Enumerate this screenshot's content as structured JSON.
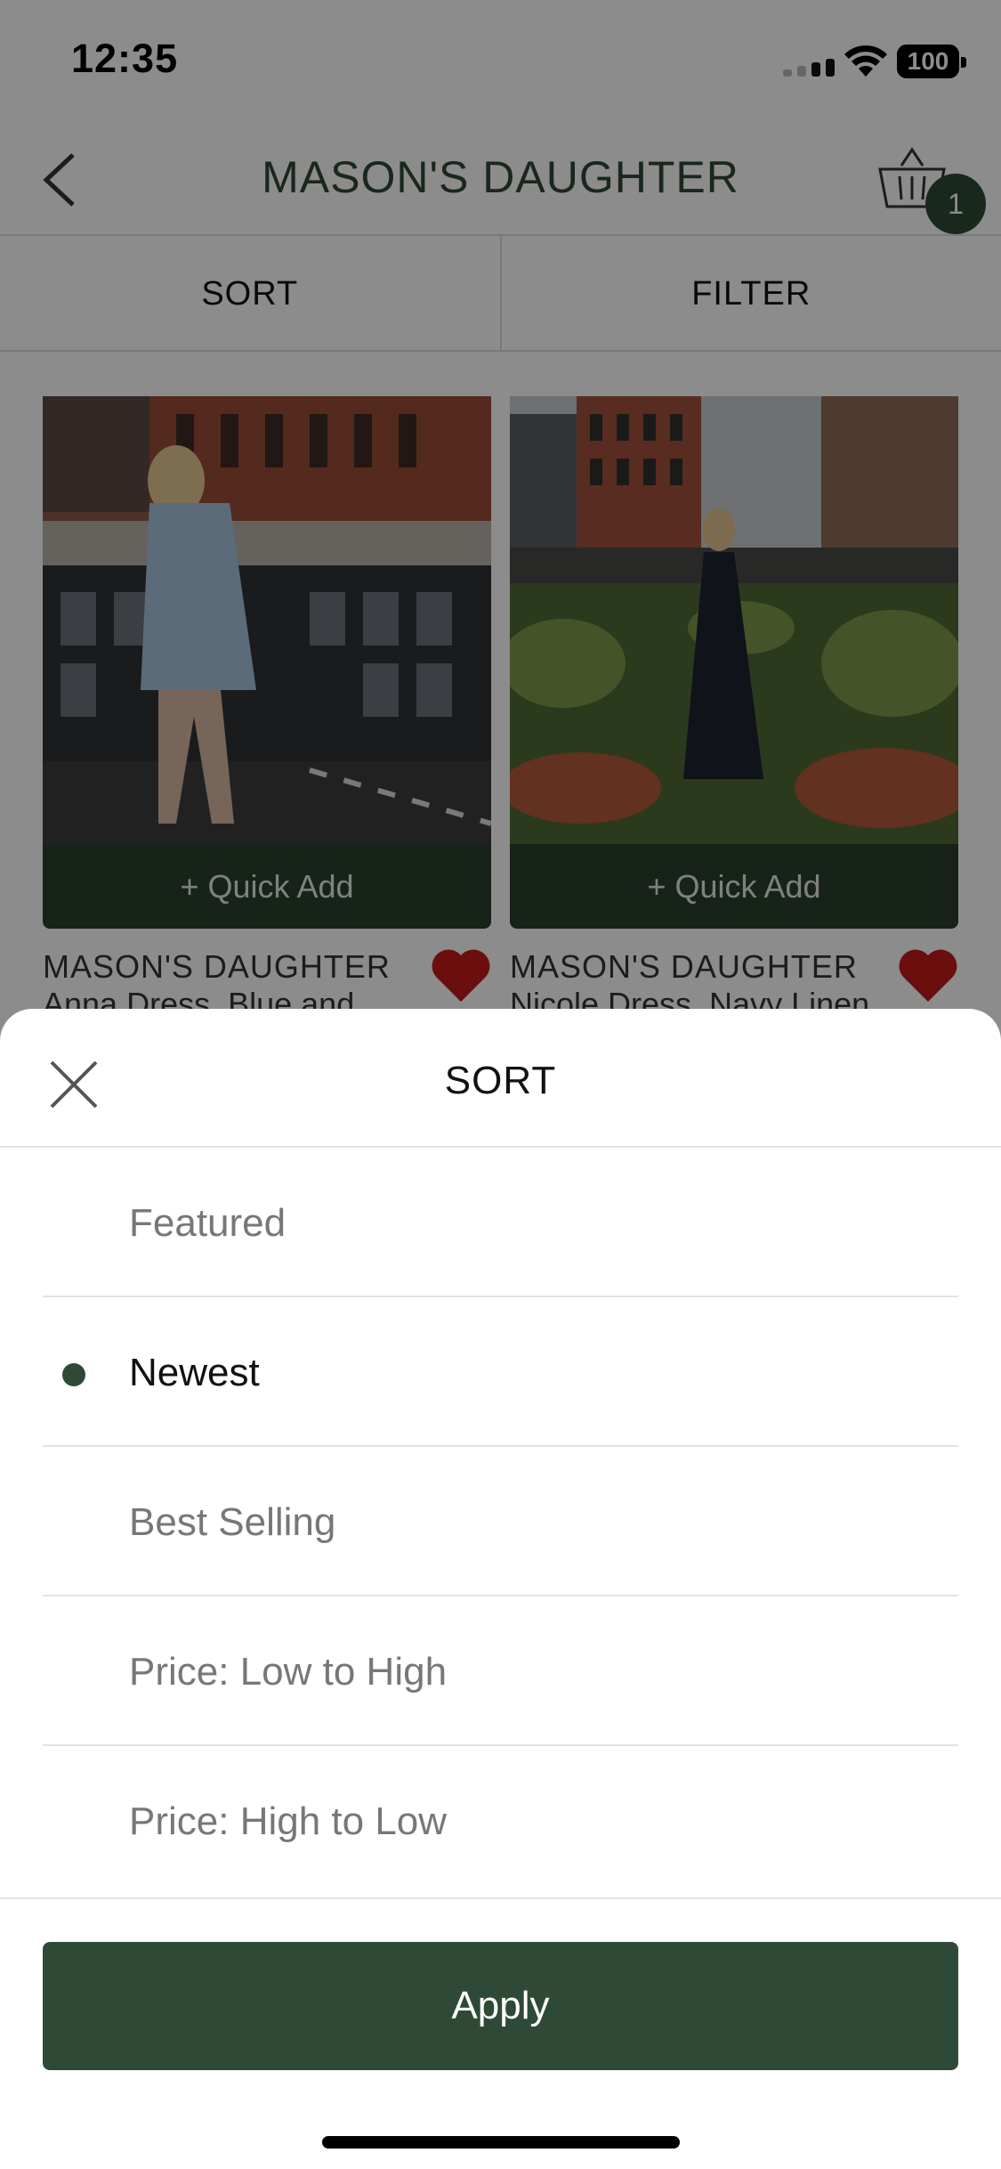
{
  "status": {
    "time": "12:35",
    "battery": "100"
  },
  "nav": {
    "title": "MASON'S DAUGHTER",
    "cart_count": "1"
  },
  "toolbar": {
    "sort_label": "SORT",
    "filter_label": "FILTER"
  },
  "products": [
    {
      "quick_add": "+ Quick Add",
      "brand": "MASON'S DAUGHTER",
      "name": "Anna Dress, Blue and",
      "favorited": true
    },
    {
      "quick_add": "+ Quick Add",
      "brand": "MASON'S DAUGHTER",
      "name": "Nicole Dress, Navy Linen",
      "favorited": true
    }
  ],
  "sort_sheet": {
    "title": "SORT",
    "options": [
      {
        "label": "Featured",
        "selected": false
      },
      {
        "label": "Newest",
        "selected": true
      },
      {
        "label": "Best Selling",
        "selected": false
      },
      {
        "label": "Price: Low to High",
        "selected": false
      },
      {
        "label": "Price: High to Low",
        "selected": false
      }
    ],
    "apply_label": "Apply"
  },
  "colors": {
    "brand_green": "#2e4a36",
    "favorite_red": "#c21b1b"
  },
  "icons": [
    "back-icon",
    "cart-icon",
    "heart-icon",
    "close-icon",
    "wifi-icon",
    "signal-icon"
  ]
}
